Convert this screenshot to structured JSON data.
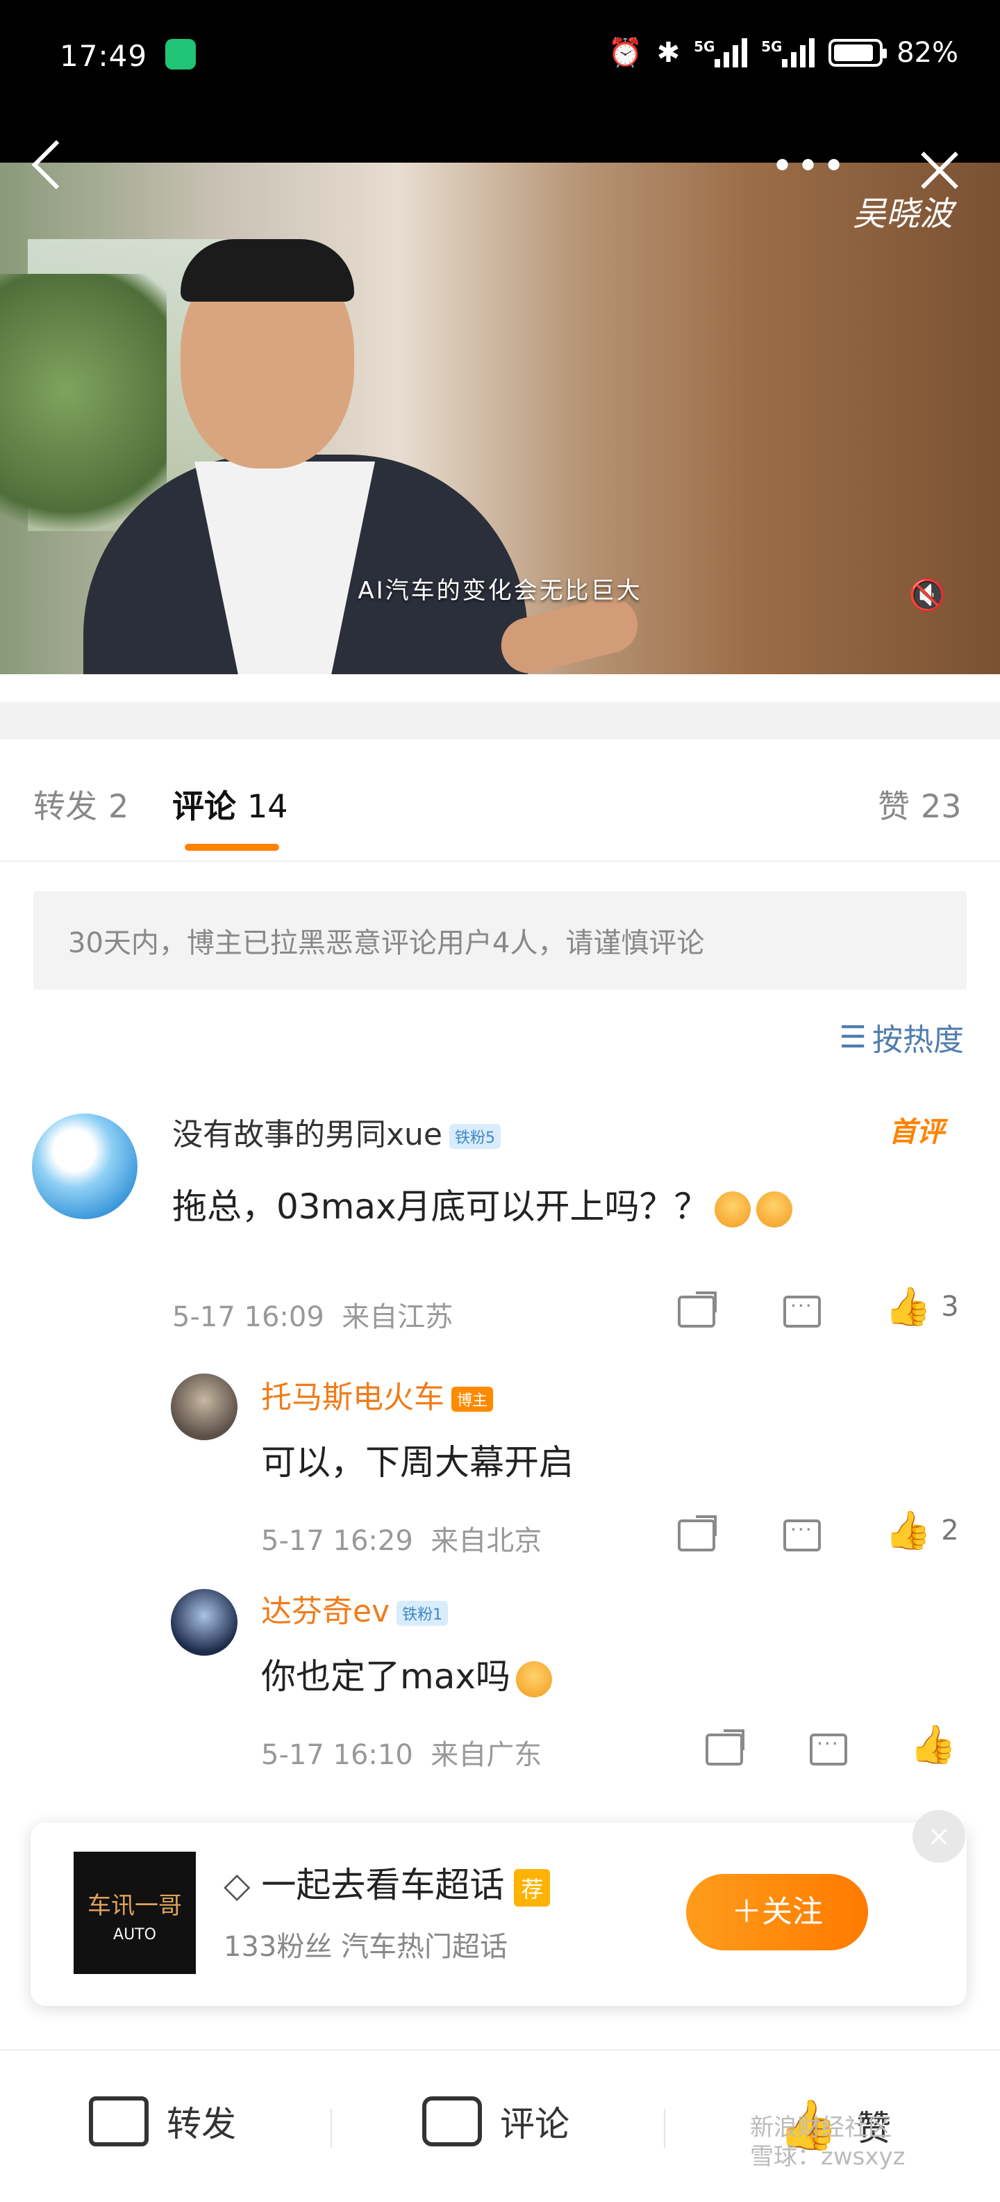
{
  "status_bar": {
    "time": "17:49",
    "network1": "5G",
    "network2": "5G",
    "battery": "82%"
  },
  "video": {
    "subtitle": "AI汽车的变化会无比巨大",
    "logo": "吴晓波",
    "more": "•••"
  },
  "tabs": [
    {
      "label": "转发",
      "count": "2"
    },
    {
      "label": "评论",
      "count": "14"
    },
    {
      "label": "赞",
      "count": "23"
    }
  ],
  "notice": "30天内，博主已拉黑恶意评论用户4人，请谨慎评论",
  "sort_label": "按热度",
  "comments": [
    {
      "user": "没有故事的男同xue",
      "badge": "铁粉5",
      "tag": "首评",
      "text": "拖总，03max月底可以开上吗？？",
      "time": "5-17 16:09",
      "location": "来自江苏",
      "likes": "3"
    }
  ],
  "replies": [
    {
      "user": "托马斯电火车",
      "badge": "博主",
      "text": "可以，下周大幕开启",
      "time": "5-17 16:29",
      "location": "来自北京",
      "likes": "2"
    },
    {
      "user": "达芬奇ev",
      "badge": "铁粉1",
      "text": "你也定了max吗",
      "time": "5-17 16:10",
      "location": "来自广东",
      "likes": ""
    }
  ],
  "card": {
    "thumb_text": "车讯一哥",
    "thumb_sub": "AUTO",
    "title": "一起去看车超话",
    "rec": "荐",
    "sub": "133粉丝  汽车热门超话",
    "follow": "＋关注",
    "close": "×"
  },
  "bottom_bar": {
    "share": "转发",
    "comment": "评论",
    "like": "赞"
  },
  "watermark": {
    "line1": "新浪财经社区",
    "line2": "雪球：zwsxyz"
  }
}
